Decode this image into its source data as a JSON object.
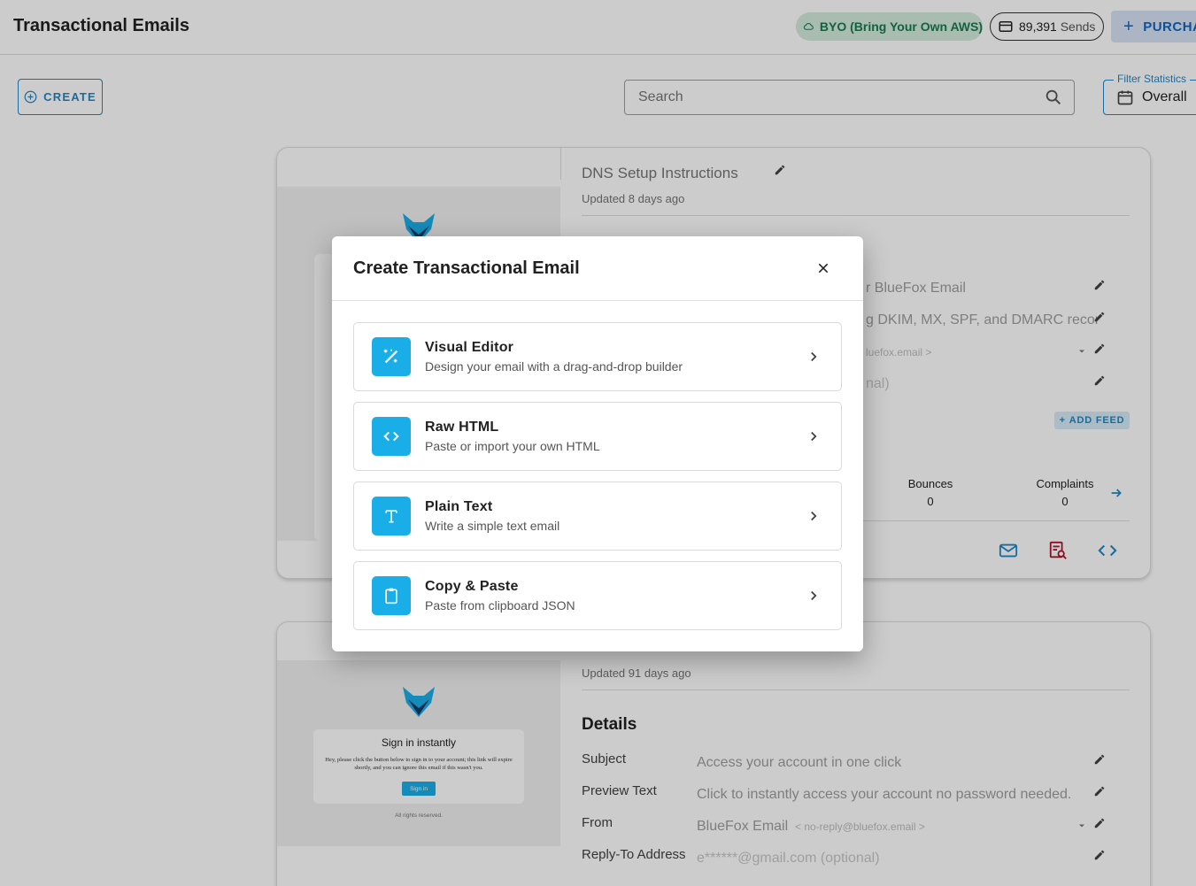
{
  "app": {
    "title": "Transactional Emails",
    "byo_label": "BYO (Bring Your Own AWS)",
    "sends_count": "89,391",
    "sends_label": "Sends",
    "purchase_label": "PURCHA"
  },
  "toolbar": {
    "create_label": "CREATE",
    "search_placeholder": "Search",
    "filter_label": "Filter Statistics",
    "filter_value": "Overall"
  },
  "cards": [
    {
      "name": "DNS Setup Instructions",
      "updated": "Updated 8 days ago",
      "subject_partial": "r BlueFox Email",
      "preview_partial": "g DKIM, MX, SPF, and DMARC record",
      "from_partial": "luefox.email >",
      "reply_partial": "nal)",
      "add_feed_label": "ADD FEED",
      "stats": {
        "bounces_label": "Bounces",
        "bounces_value": "0",
        "complaints_label": "Complaints",
        "complaints_value": "0"
      }
    },
    {
      "updated": "Updated 91 days ago",
      "details_heading": "Details",
      "preview_title": "Sign in instantly",
      "preview_body": "Hey, please click the button below to sign in to your account; this link will expire shortly, and you can ignore this email if this wasn't you.",
      "preview_button": "Sign in",
      "preview_footer": "All rights reserved.",
      "details": [
        {
          "label": "Subject",
          "value": "Access your account in one click"
        },
        {
          "label": "Preview Text",
          "value": "Click to instantly access your account no password needed."
        },
        {
          "label": "From",
          "value": "BlueFox Email",
          "extra": "< no-reply@bluefox.email >"
        },
        {
          "label": "Reply-To Address",
          "value": "e******@gmail.com (optional)"
        }
      ]
    }
  ],
  "modal": {
    "title": "Create Transactional Email",
    "options": [
      {
        "title": "Visual Editor",
        "subtitle": "Design your email with a drag-and-drop builder",
        "icon": "magic-wand-icon"
      },
      {
        "title": "Raw HTML",
        "subtitle": "Paste or import your own HTML",
        "icon": "code-icon"
      },
      {
        "title": "Plain Text",
        "subtitle": "Write a simple text email",
        "icon": "text-t-icon"
      },
      {
        "title": "Copy & Paste",
        "subtitle": "Paste from clipboard JSON",
        "icon": "clipboard-icon"
      }
    ]
  },
  "colors": {
    "accent": "#1e88c7",
    "option_icon_bg": "#1aaee8",
    "byo_bg": "#d3ecdc",
    "byo_text": "#1a7a51"
  }
}
